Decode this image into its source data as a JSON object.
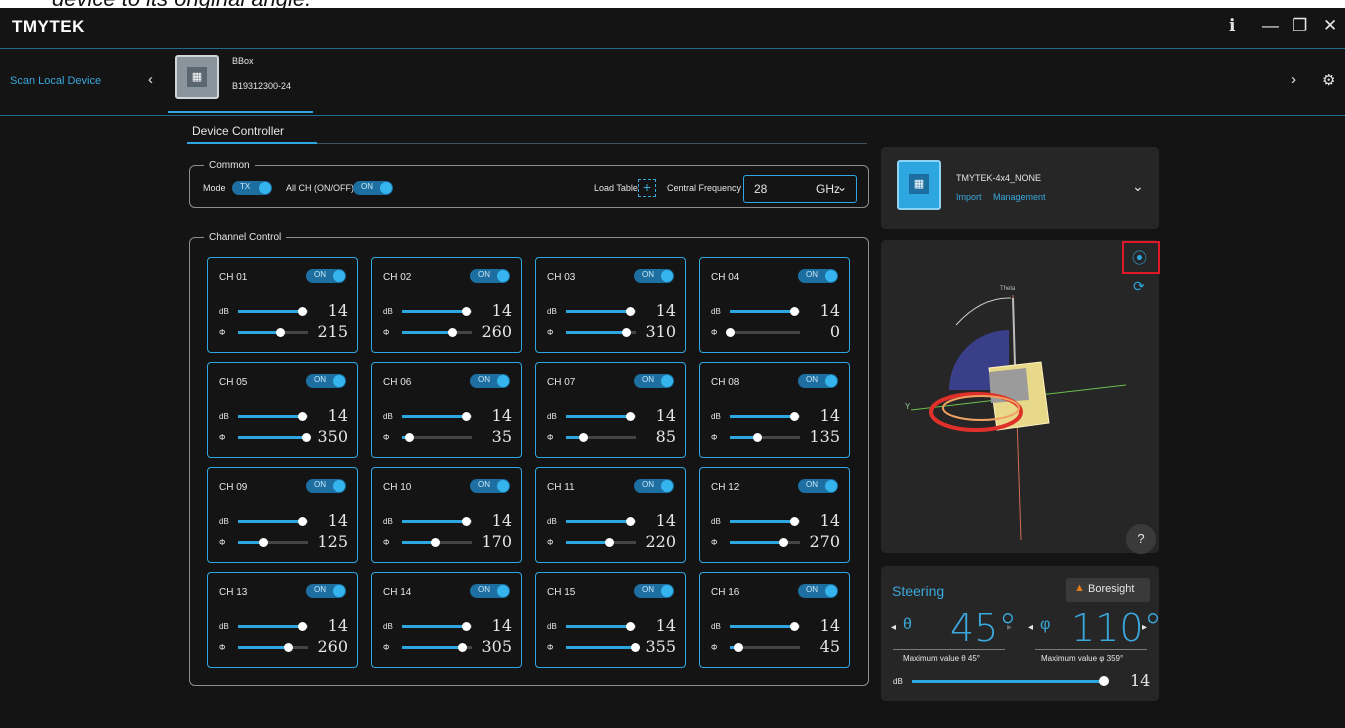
{
  "top_text": "device to its original angle.",
  "app": {
    "logo": "TMYTEK"
  },
  "window_controls": [
    "ℹ",
    "—",
    "❐",
    "✕"
  ],
  "device_bar": {
    "scan_label": "Scan Local Device",
    "device_name": "BBox",
    "device_serial": "B19312300-24"
  },
  "tabs": {
    "controller": "Device Controller"
  },
  "common": {
    "legend": "Common",
    "mode_label": "Mode",
    "mode_value": "TX",
    "all_ch_label": "All CH (ON/OFF)",
    "all_ch_value": "ON",
    "load_table_label": "Load Table",
    "central_freq_label": "Central Frequency",
    "freq_value": "28",
    "freq_unit": "GHz"
  },
  "channel_control": {
    "legend": "Channel Control",
    "db_label": "dB",
    "phase_label": "Φ",
    "on_label": "ON",
    "channels": [
      {
        "name": "CH 01",
        "db": "14",
        "phase": "215",
        "db_level": 0.92,
        "phase_level": 0.6
      },
      {
        "name": "CH 02",
        "db": "14",
        "phase": "260",
        "db_level": 0.92,
        "phase_level": 0.72
      },
      {
        "name": "CH 03",
        "db": "14",
        "phase": "310",
        "db_level": 0.92,
        "phase_level": 0.86
      },
      {
        "name": "CH 04",
        "db": "14",
        "phase": "0",
        "db_level": 0.92,
        "phase_level": 0.0
      },
      {
        "name": "CH 05",
        "db": "14",
        "phase": "350",
        "db_level": 0.92,
        "phase_level": 0.97
      },
      {
        "name": "CH 06",
        "db": "14",
        "phase": "35",
        "db_level": 0.92,
        "phase_level": 0.1
      },
      {
        "name": "CH 07",
        "db": "14",
        "phase": "85",
        "db_level": 0.92,
        "phase_level": 0.24
      },
      {
        "name": "CH 08",
        "db": "14",
        "phase": "135",
        "db_level": 0.92,
        "phase_level": 0.38
      },
      {
        "name": "CH 09",
        "db": "14",
        "phase": "125",
        "db_level": 0.92,
        "phase_level": 0.35
      },
      {
        "name": "CH 10",
        "db": "14",
        "phase": "170",
        "db_level": 0.92,
        "phase_level": 0.47
      },
      {
        "name": "CH 11",
        "db": "14",
        "phase": "220",
        "db_level": 0.92,
        "phase_level": 0.61
      },
      {
        "name": "CH 12",
        "db": "14",
        "phase": "270",
        "db_level": 0.92,
        "phase_level": 0.75
      },
      {
        "name": "CH 13",
        "db": "14",
        "phase": "260",
        "db_level": 0.92,
        "phase_level": 0.72
      },
      {
        "name": "CH 14",
        "db": "14",
        "phase": "305",
        "db_level": 0.92,
        "phase_level": 0.85
      },
      {
        "name": "CH 15",
        "db": "14",
        "phase": "355",
        "db_level": 0.92,
        "phase_level": 0.99
      },
      {
        "name": "CH 16",
        "db": "14",
        "phase": "45",
        "db_level": 0.92,
        "phase_level": 0.12
      }
    ]
  },
  "device_panel": {
    "name": "TMYTEK-4x4_NONE",
    "import": "Import",
    "management": "Management"
  },
  "view3d": {
    "theta_label": "Theta",
    "y_label": "Y",
    "help": "?"
  },
  "steering": {
    "title": "Steering",
    "boresight": "Boresight",
    "theta_symbol": "θ",
    "phi_symbol": "φ",
    "theta_value": "45°",
    "phi_value": "110°",
    "theta_max": "Maximum value θ 45°",
    "phi_max": "Maximum value φ 359°",
    "db_label": "dB",
    "db_value": "14",
    "db_level": 0.97
  },
  "colors": {
    "accent": "#2ea7e0",
    "highlight": "#e0192a",
    "background": "#141414",
    "panel": "#262626"
  }
}
